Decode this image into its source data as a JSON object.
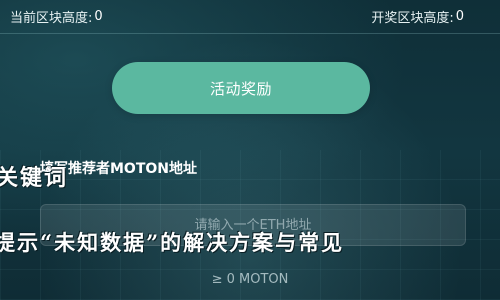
{
  "stats": {
    "current_height_label": "当前区块高度:",
    "current_height_value": "0",
    "reward_height_label": "开奖区块高度:",
    "reward_height_value": "0"
  },
  "cta": {
    "label": "活动奖励"
  },
  "referrer": {
    "label": "填写推荐者MOTON地址",
    "placeholder": "请输入一个ETH地址",
    "hint": "≥ 0 MOTON"
  },
  "overlay": {
    "keyword": "关键词",
    "headline": "提示“未知数据”的解决方案与常见"
  },
  "colors": {
    "accent": "#5bb8a0",
    "background": "#0f2f38"
  }
}
